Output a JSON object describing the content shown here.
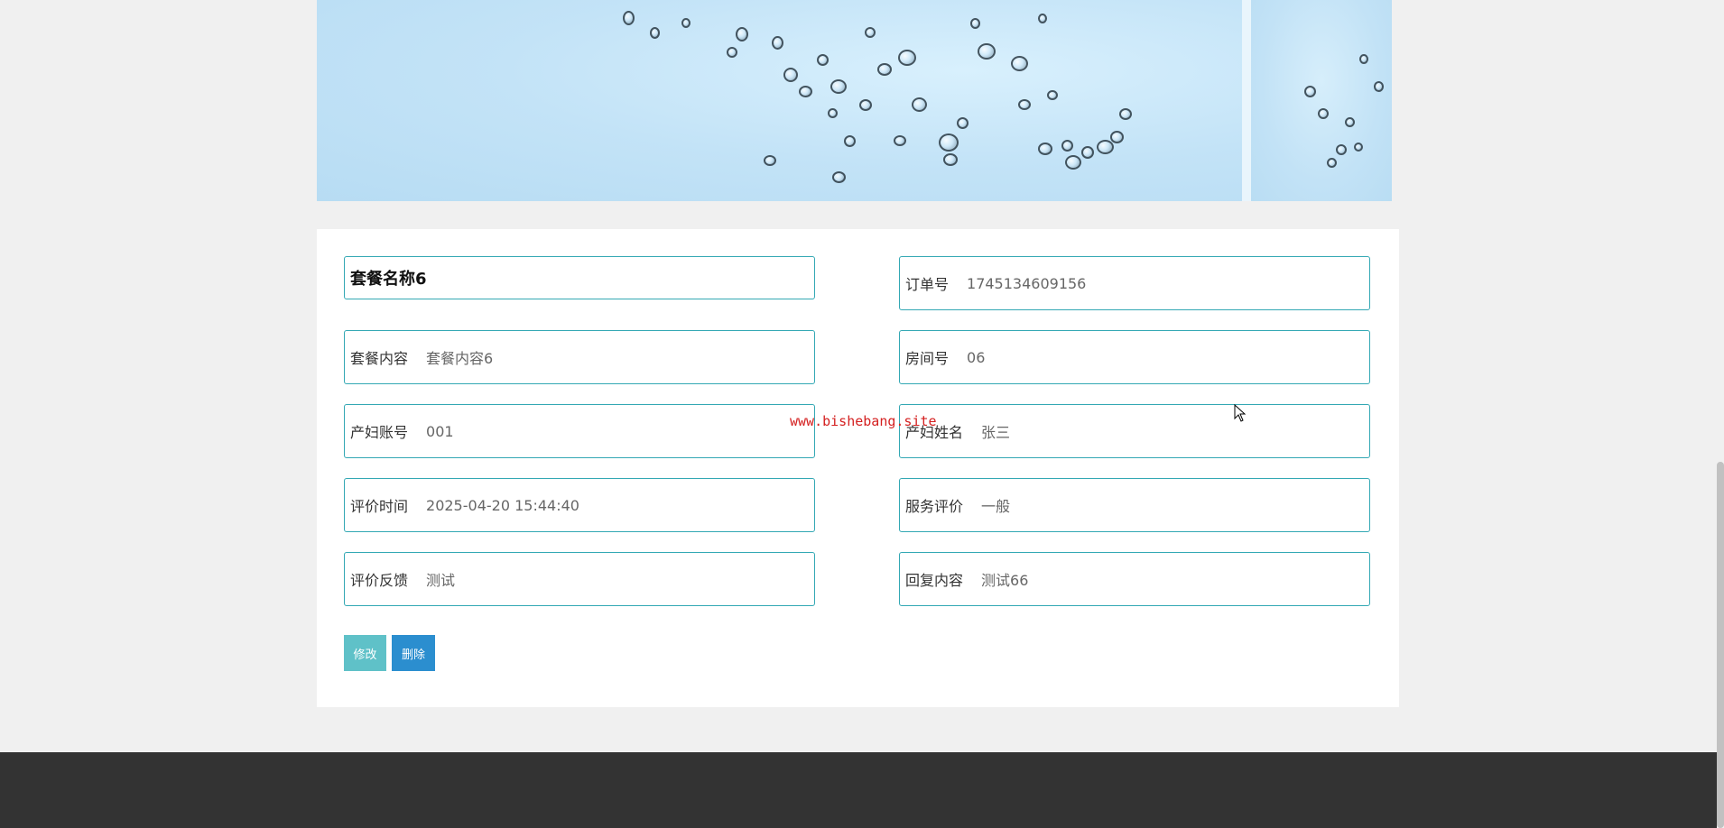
{
  "detail": {
    "title": "套餐名称6",
    "fields": [
      {
        "label": "订单号",
        "value": "1745134609156"
      },
      {
        "label": "套餐内容",
        "value": "套餐内容6"
      },
      {
        "label": "房间号",
        "value": "06"
      },
      {
        "label": "产妇账号",
        "value": "001"
      },
      {
        "label": "产妇姓名",
        "value": "张三"
      },
      {
        "label": "评价时间",
        "value": "2025-04-20 15:44:40"
      },
      {
        "label": "服务评价",
        "value": "一般"
      },
      {
        "label": "评价反馈",
        "value": "测试"
      },
      {
        "label": "回复内容",
        "value": "测试66"
      }
    ]
  },
  "actions": {
    "edit_label": "修改",
    "delete_label": "删除"
  },
  "watermark": "www.bishebang.site",
  "colors": {
    "field_border": "#33a8b4",
    "edit_button": "#5fc1c8",
    "delete_button": "#2b8ecf",
    "footer": "#333333",
    "watermark": "#d42020"
  },
  "icons": {
    "cursor": "mouse-pointer-icon"
  }
}
